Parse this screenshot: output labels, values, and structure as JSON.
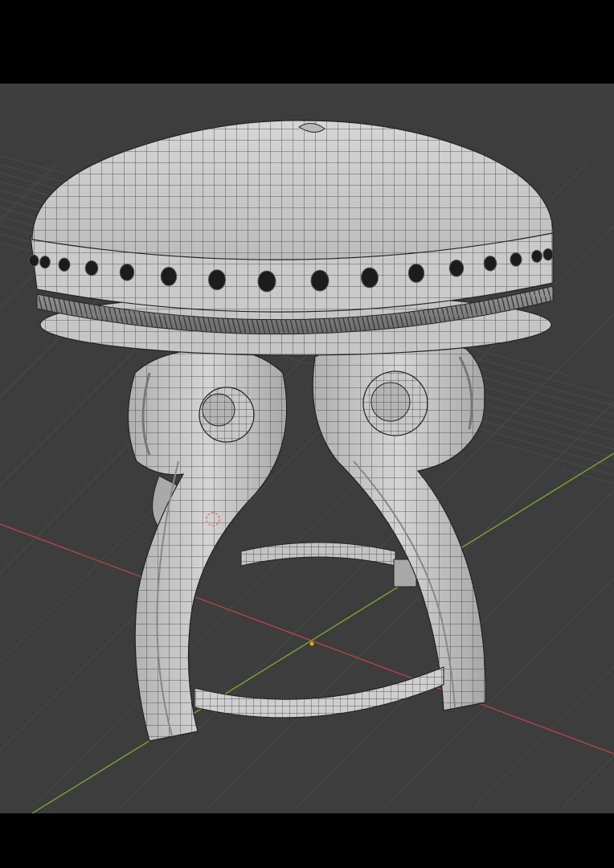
{
  "viewport": {
    "background": "#3d3d3d",
    "grid_color": "#4a4a4a",
    "x_axis_color": "#b8424e",
    "y_axis_color": "#7fae2e",
    "origin_color": "#e8b100",
    "cursor_color": "#d24a4a",
    "shading": "solid-wireframe",
    "object": "upholstered-stool"
  }
}
